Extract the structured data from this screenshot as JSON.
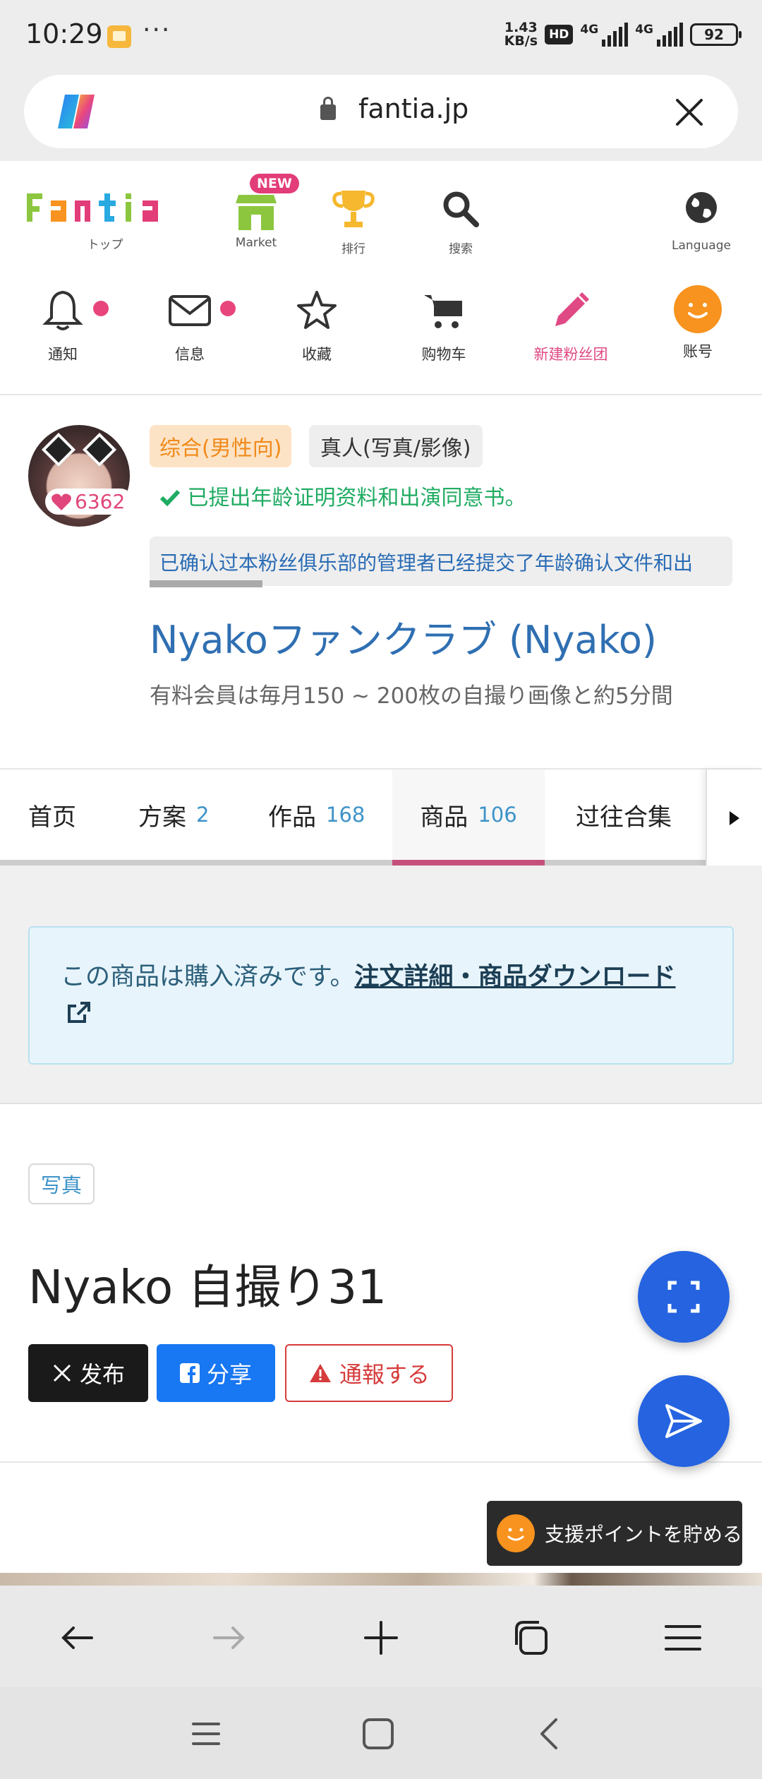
{
  "status": {
    "time": "10:29",
    "more": "···",
    "speed_top": "1.43",
    "speed_bottom": "KB/s",
    "hd": "HD",
    "net1": "4G",
    "net2": "4G",
    "battery": "92"
  },
  "browser": {
    "url": "fantia.jp"
  },
  "site_nav": {
    "top_label": "トップ",
    "market_label": "Market",
    "new_badge": "NEW",
    "ranking_label": "排行",
    "search_label": "搜索",
    "language_label": "Language",
    "notify_label": "通知",
    "message_label": "信息",
    "favorite_label": "收藏",
    "cart_label": "购物车",
    "newclub_label": "新建粉丝团",
    "account_label": "账号"
  },
  "profile": {
    "likes": "6362",
    "category_tag": "综合(男性向)",
    "real_tag": "真人(写真/影像)",
    "verified": "已提出年龄证明资料和出演同意书。",
    "marquee": "已确认过本粉丝俱乐部的管理者已经提交了年龄确认文件和出",
    "club_title": "Nyakoファンクラブ (Nyako)",
    "club_desc": "有料会員は毎月150 ~ 200枚の自撮り画像と約5分間"
  },
  "tabs": {
    "home": "首页",
    "plans": "方案",
    "plans_count": "2",
    "works": "作品",
    "works_count": "168",
    "products": "商品",
    "products_count": "106",
    "archive": "过往合集"
  },
  "notice": {
    "text": "この商品は購入済みです。",
    "link": "注文詳細・商品ダウンロード"
  },
  "product": {
    "tag": "写真",
    "title": "Nyako 自撮り31",
    "post_x": "发布",
    "share_fb": "分享",
    "report": "通報する"
  },
  "support": {
    "label": "支援ポイントを貯める"
  },
  "colors": {
    "accent_blue": "#2563e0",
    "club_title": "#2f6fb2",
    "active_tab": "#c6507c",
    "verified_green": "#1fab62"
  }
}
